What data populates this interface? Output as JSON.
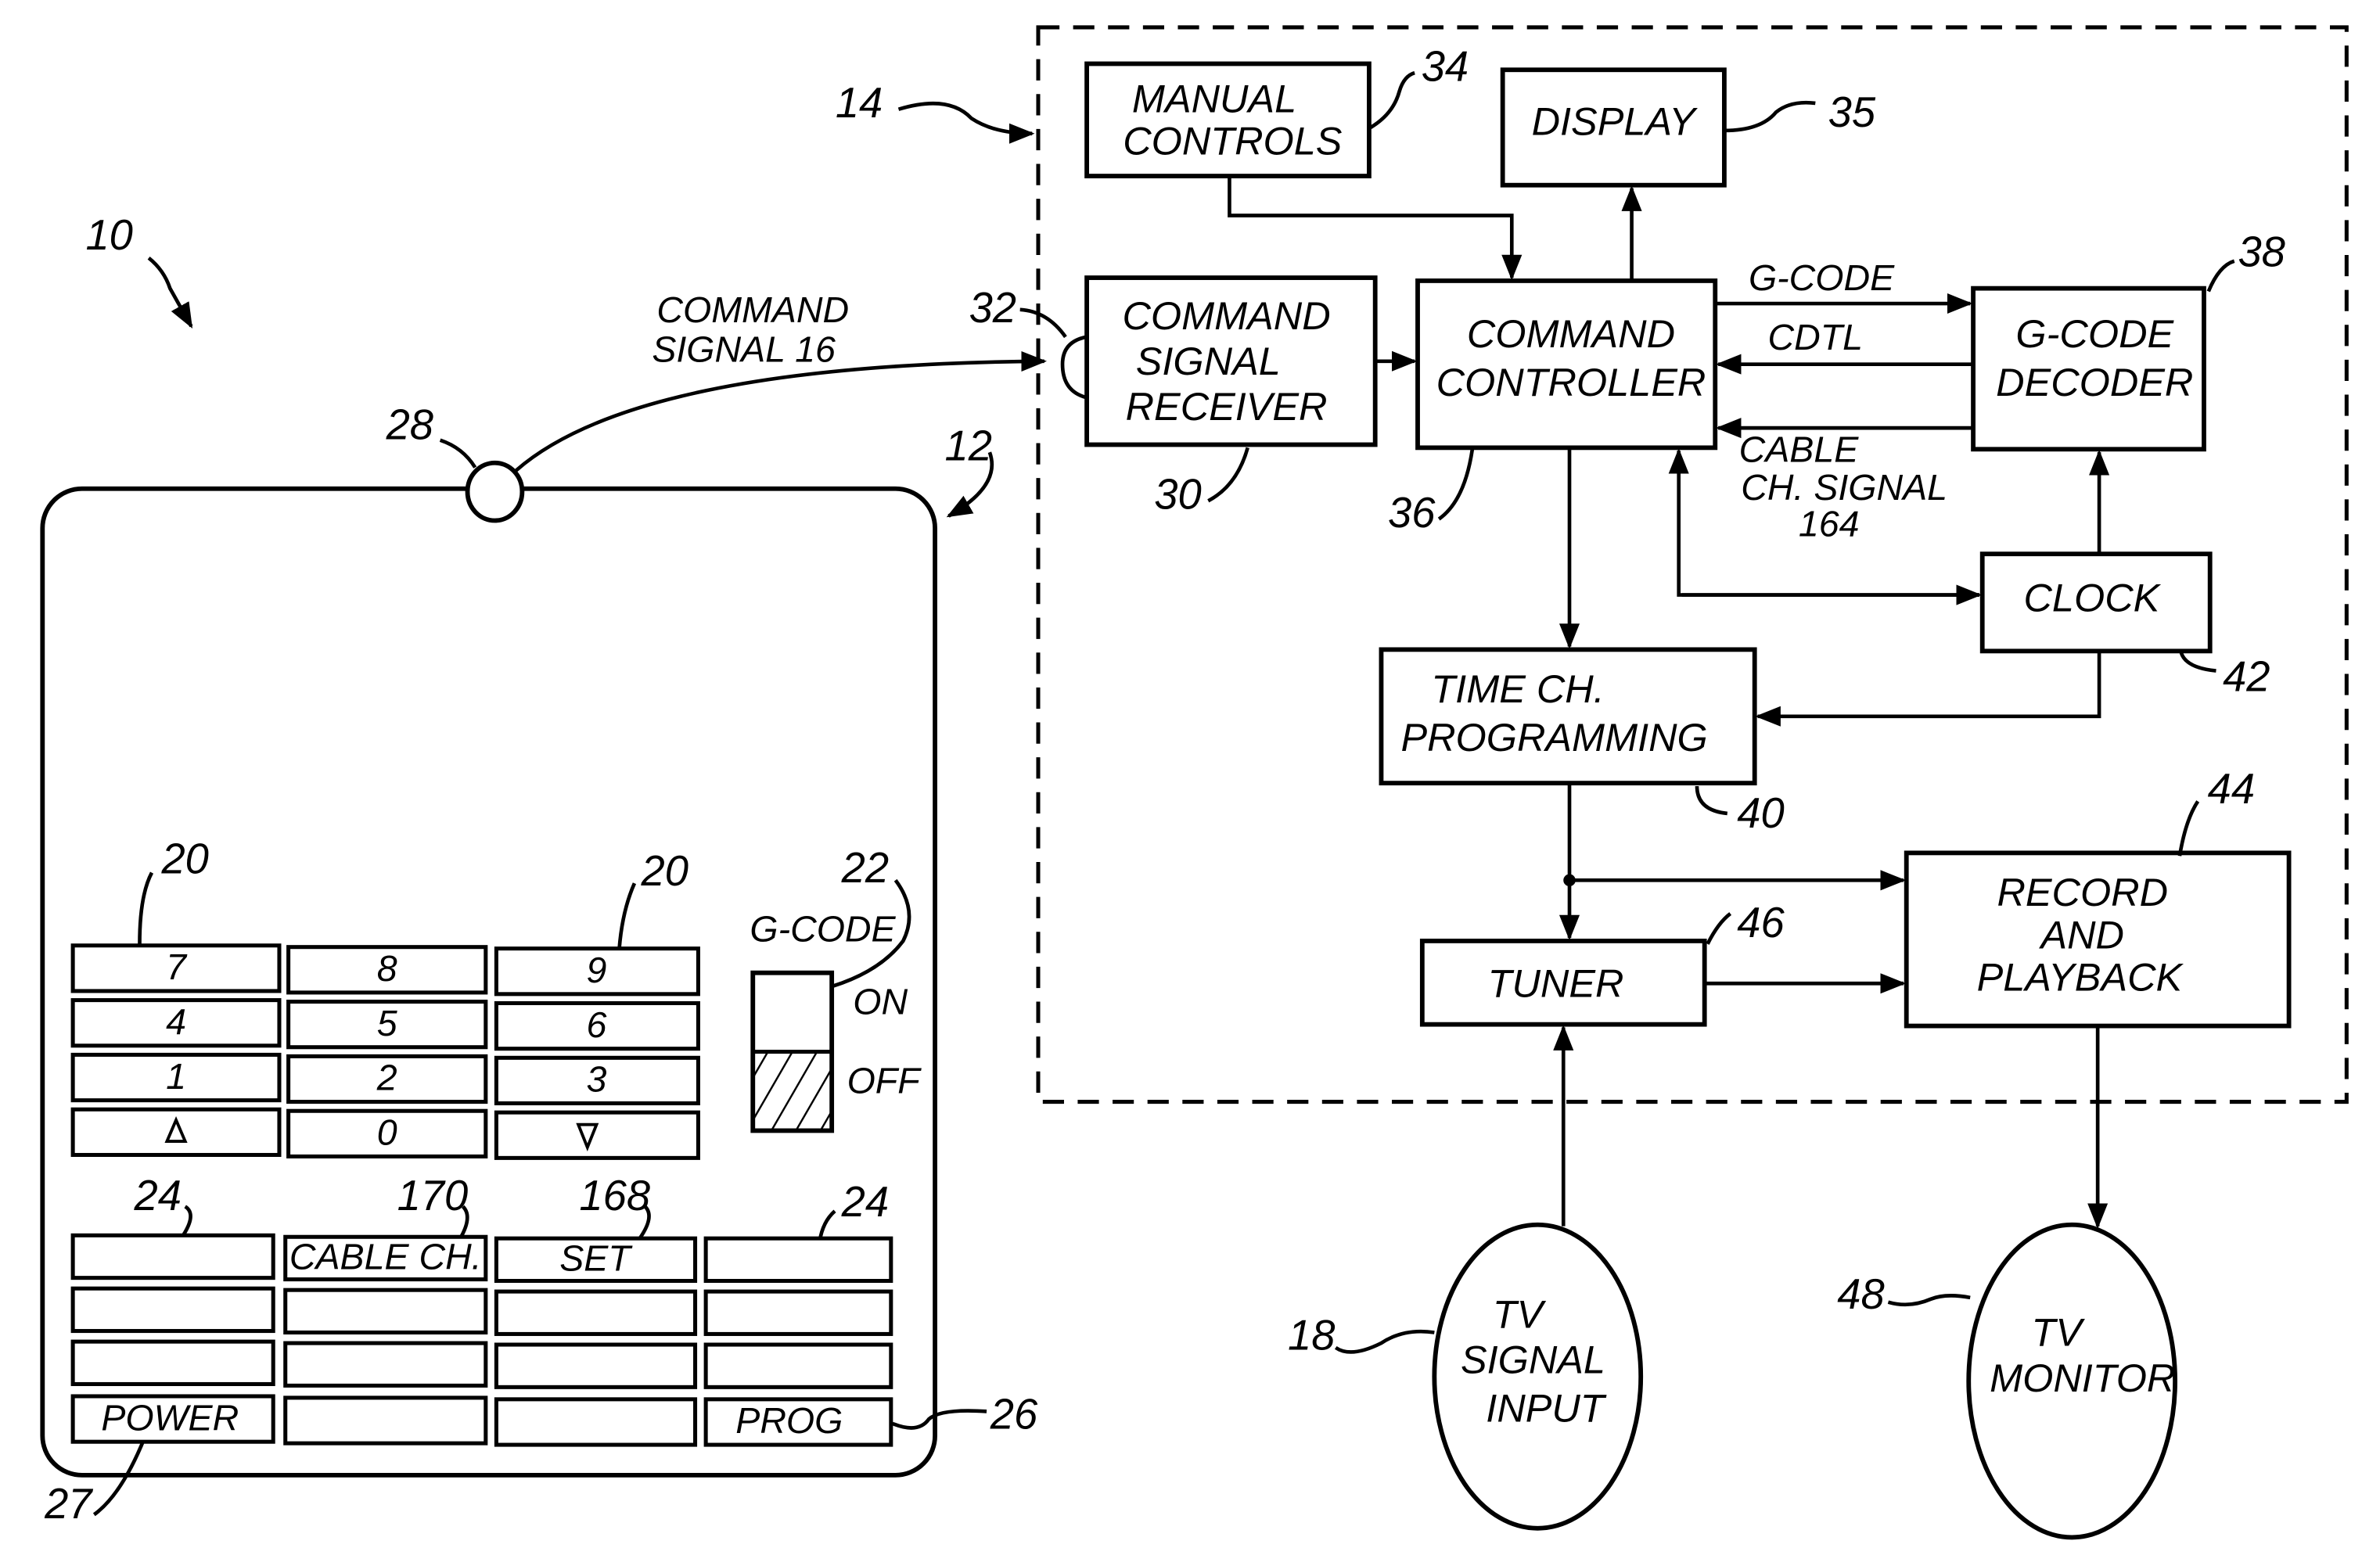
{
  "figure": {
    "system_ref": "10",
    "remote": {
      "ref": "12",
      "emitter_ref": "28",
      "command_signal": {
        "line1": "COMMAND",
        "line2": "SIGNAL 16"
      },
      "number_keys_ref_left": "20",
      "number_keys_ref_right": "20",
      "number_keys": [
        [
          "7",
          "8",
          "9"
        ],
        [
          "4",
          "5",
          "6"
        ],
        [
          "1",
          "2",
          "3"
        ],
        [
          "up-triangle-icon",
          "0",
          "down-triangle-icon"
        ]
      ],
      "gcode_switch": {
        "ref": "22",
        "label": "G-CODE",
        "on_label": "ON",
        "off_label": "OFF",
        "state": "OFF"
      },
      "function_keys_refs": {
        "left": "24",
        "cable_ch": "170",
        "set": "168",
        "right": "24",
        "power": "27",
        "prog": "26"
      },
      "function_keys": [
        [
          "",
          "CABLE CH.",
          "SET",
          ""
        ],
        [
          "",
          "",
          "",
          ""
        ],
        [
          "",
          "",
          "",
          ""
        ],
        [
          "POWER",
          "",
          "",
          "PROG"
        ]
      ]
    },
    "vcr": {
      "ref": "14",
      "blocks": {
        "manual_controls": {
          "ref": "34",
          "line1": "MANUAL",
          "line2": "CONTROLS"
        },
        "display": {
          "ref": "35",
          "label": "DISPLAY"
        },
        "receiver": {
          "ref": "30",
          "line1": "COMMAND",
          "line2": "SIGNAL",
          "line3": "RECEIVER",
          "port_ref": "32"
        },
        "controller": {
          "ref": "36",
          "line1": "COMMAND",
          "line2": "CONTROLLER"
        },
        "decoder": {
          "ref": "38",
          "line1": "G-CODE",
          "line2": "DECODER"
        },
        "clock": {
          "ref": "42",
          "label": "CLOCK"
        },
        "programming": {
          "ref": "40",
          "line1": "TIME CH.",
          "line2": "PROGRAMMING"
        },
        "tuner": {
          "ref": "46",
          "label": "TUNER"
        },
        "record": {
          "ref": "44",
          "line1": "RECORD",
          "line2": "AND",
          "line3": "PLAYBACK"
        }
      },
      "signals": {
        "gcode": "G-CODE",
        "cdtl": "CDTL",
        "cable1": "CABLE",
        "cable2": "CH. SIGNAL",
        "cable3": "164"
      }
    },
    "externals": {
      "tv_input": {
        "ref": "18",
        "line1": "TV",
        "line2": "SIGNAL",
        "line3": "INPUT"
      },
      "tv_monitor": {
        "ref": "48",
        "line1": "TV",
        "line2": "MONITOR"
      }
    }
  }
}
